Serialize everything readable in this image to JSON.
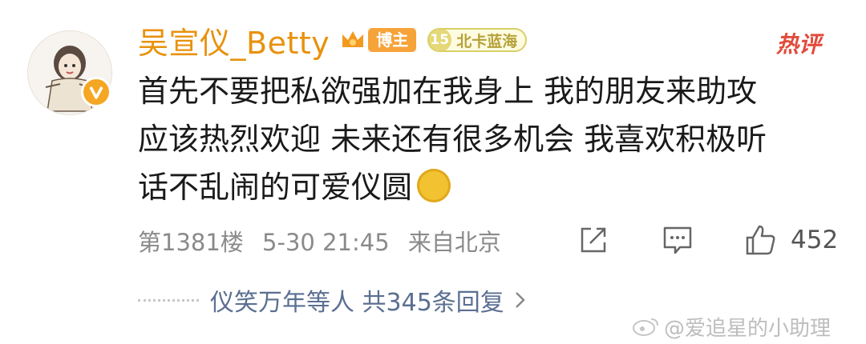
{
  "user": {
    "name": "吴宣仪_Betty",
    "blogger_badge": "博主",
    "fan_level": "15",
    "fan_name": "北卡蓝海"
  },
  "hot_tag": "热评",
  "comment": {
    "lines": [
      "首先不要把私欲强加在我身上  我的朋友来助攻",
      "应该热烈欢迎 未来还有很多机会 我喜欢积极听",
      "话不乱闹的可爱仪圆"
    ]
  },
  "meta": {
    "floor": "第1381楼",
    "datetime": "5-30 21:45",
    "location": "来自北京"
  },
  "actions": {
    "like_count": "452"
  },
  "replies": {
    "summary": "仪笑万年等人  共345条回复"
  },
  "watermark": "@爱追星的小助理",
  "colors": {
    "username": "#e8920e",
    "hot_tag": "#e24a3b",
    "reply_link": "#5b6f91",
    "meta": "#8a8a8a"
  },
  "icons": {
    "verify": "verified-v-icon",
    "crown": "crown-icon",
    "share": "share-icon",
    "comment": "comment-icon",
    "like": "thumbs-up-icon",
    "chevron": "chevron-right-icon",
    "emoji": "coin-emoji-icon"
  }
}
